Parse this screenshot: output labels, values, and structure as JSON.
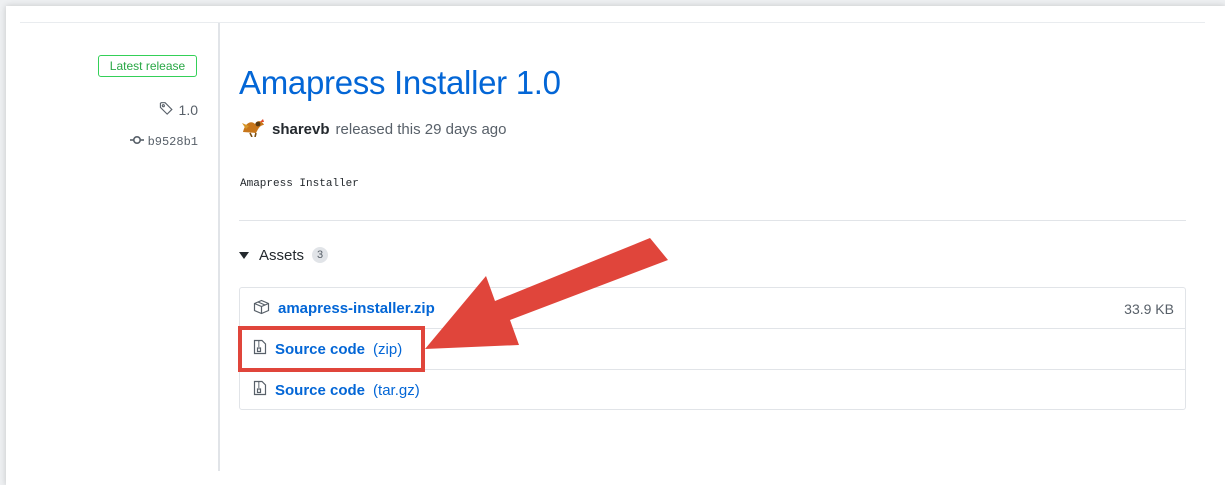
{
  "sidebar": {
    "badge": "Latest release",
    "tag": "1.0",
    "commit": "b9528b1"
  },
  "release": {
    "title": "Amapress Installer 1.0",
    "author": "sharevb",
    "released_text": "released this 29 days ago",
    "body": "Amapress Installer"
  },
  "assets": {
    "label": "Assets",
    "count": "3",
    "items": [
      {
        "icon": "package-icon",
        "name": "amapress-installer.zip",
        "size": "33.9 KB"
      },
      {
        "icon": "file-zip-icon",
        "name": "Source code",
        "suffix": "(zip)"
      },
      {
        "icon": "file-zip-icon",
        "name": "Source code",
        "suffix": "(tar.gz)"
      }
    ]
  },
  "annotation": {
    "color": "#e0453b",
    "target": "Source code (zip)"
  },
  "colors": {
    "link": "#0366d6",
    "badge_green": "#28a745",
    "muted": "#586069"
  }
}
